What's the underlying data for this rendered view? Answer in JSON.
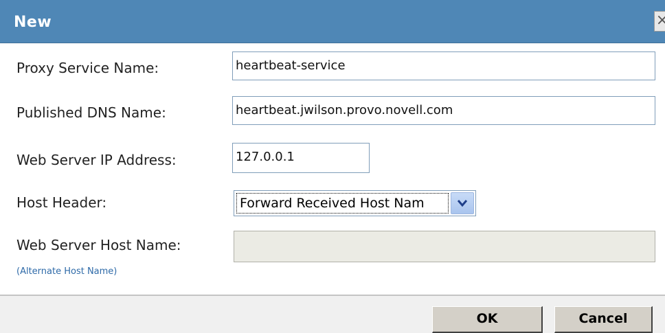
{
  "dialog": {
    "title": "New",
    "close_icon": "close-icon"
  },
  "form": {
    "proxy_service_name": {
      "label": "Proxy Service Name:",
      "value": "heartbeat-service"
    },
    "published_dns_name": {
      "label": "Published DNS Name:",
      "value": "heartbeat.jwilson.provo.novell.com"
    },
    "web_server_ip": {
      "label": "Web Server IP Address:",
      "value": "127.0.0.1"
    },
    "host_header": {
      "label": "Host Header:",
      "selected": "Forward Received Host Nam"
    },
    "web_server_host_name": {
      "label": "Web Server Host Name:",
      "value": "",
      "alternate_link": "(Alternate Host Name)"
    }
  },
  "buttons": {
    "ok": "OK",
    "cancel": "Cancel"
  },
  "colors": {
    "titlebar": "#4f87b6",
    "link": "#2e6aa8"
  }
}
